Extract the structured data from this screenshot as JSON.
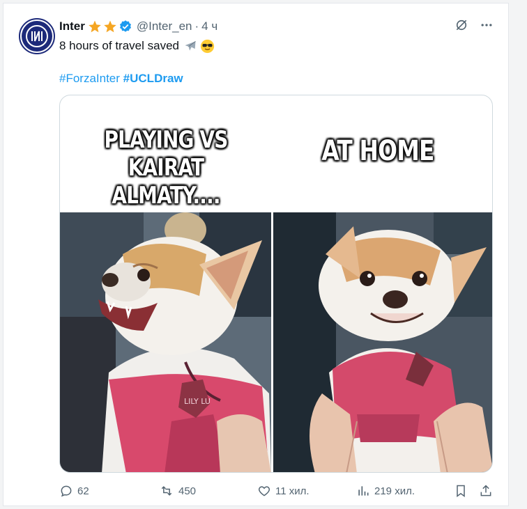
{
  "tweet": {
    "author_name": "Inter",
    "handle": "@Inter_en",
    "separator": "·",
    "time": "4 ч",
    "text": "8 hours of travel saved",
    "hashtags": [
      "#ForzaInter",
      "#UCLDraw"
    ]
  },
  "media": {
    "caption_left_line1": "PLAYING VS",
    "caption_left_line2": "KAIRAT ALMATY....",
    "caption_right": "AT HOME",
    "collar_tag_text": "LILY LU"
  },
  "actions": {
    "replies": "62",
    "reposts": "450",
    "likes": "11 хил.",
    "views": "219 хил."
  },
  "icons": {
    "verified": "verified-badge-icon",
    "stars": "star-icon",
    "grok": "grok-icon",
    "more": "more-icon",
    "reply": "reply-icon",
    "repost": "repost-icon",
    "like": "heart-icon",
    "views": "views-icon",
    "bookmark": "bookmark-icon",
    "share": "share-icon"
  },
  "colors": {
    "accent": "#1d9bf0",
    "muted": "#536471",
    "star": "#f5a623",
    "club_blue": "#1d2a7a"
  }
}
